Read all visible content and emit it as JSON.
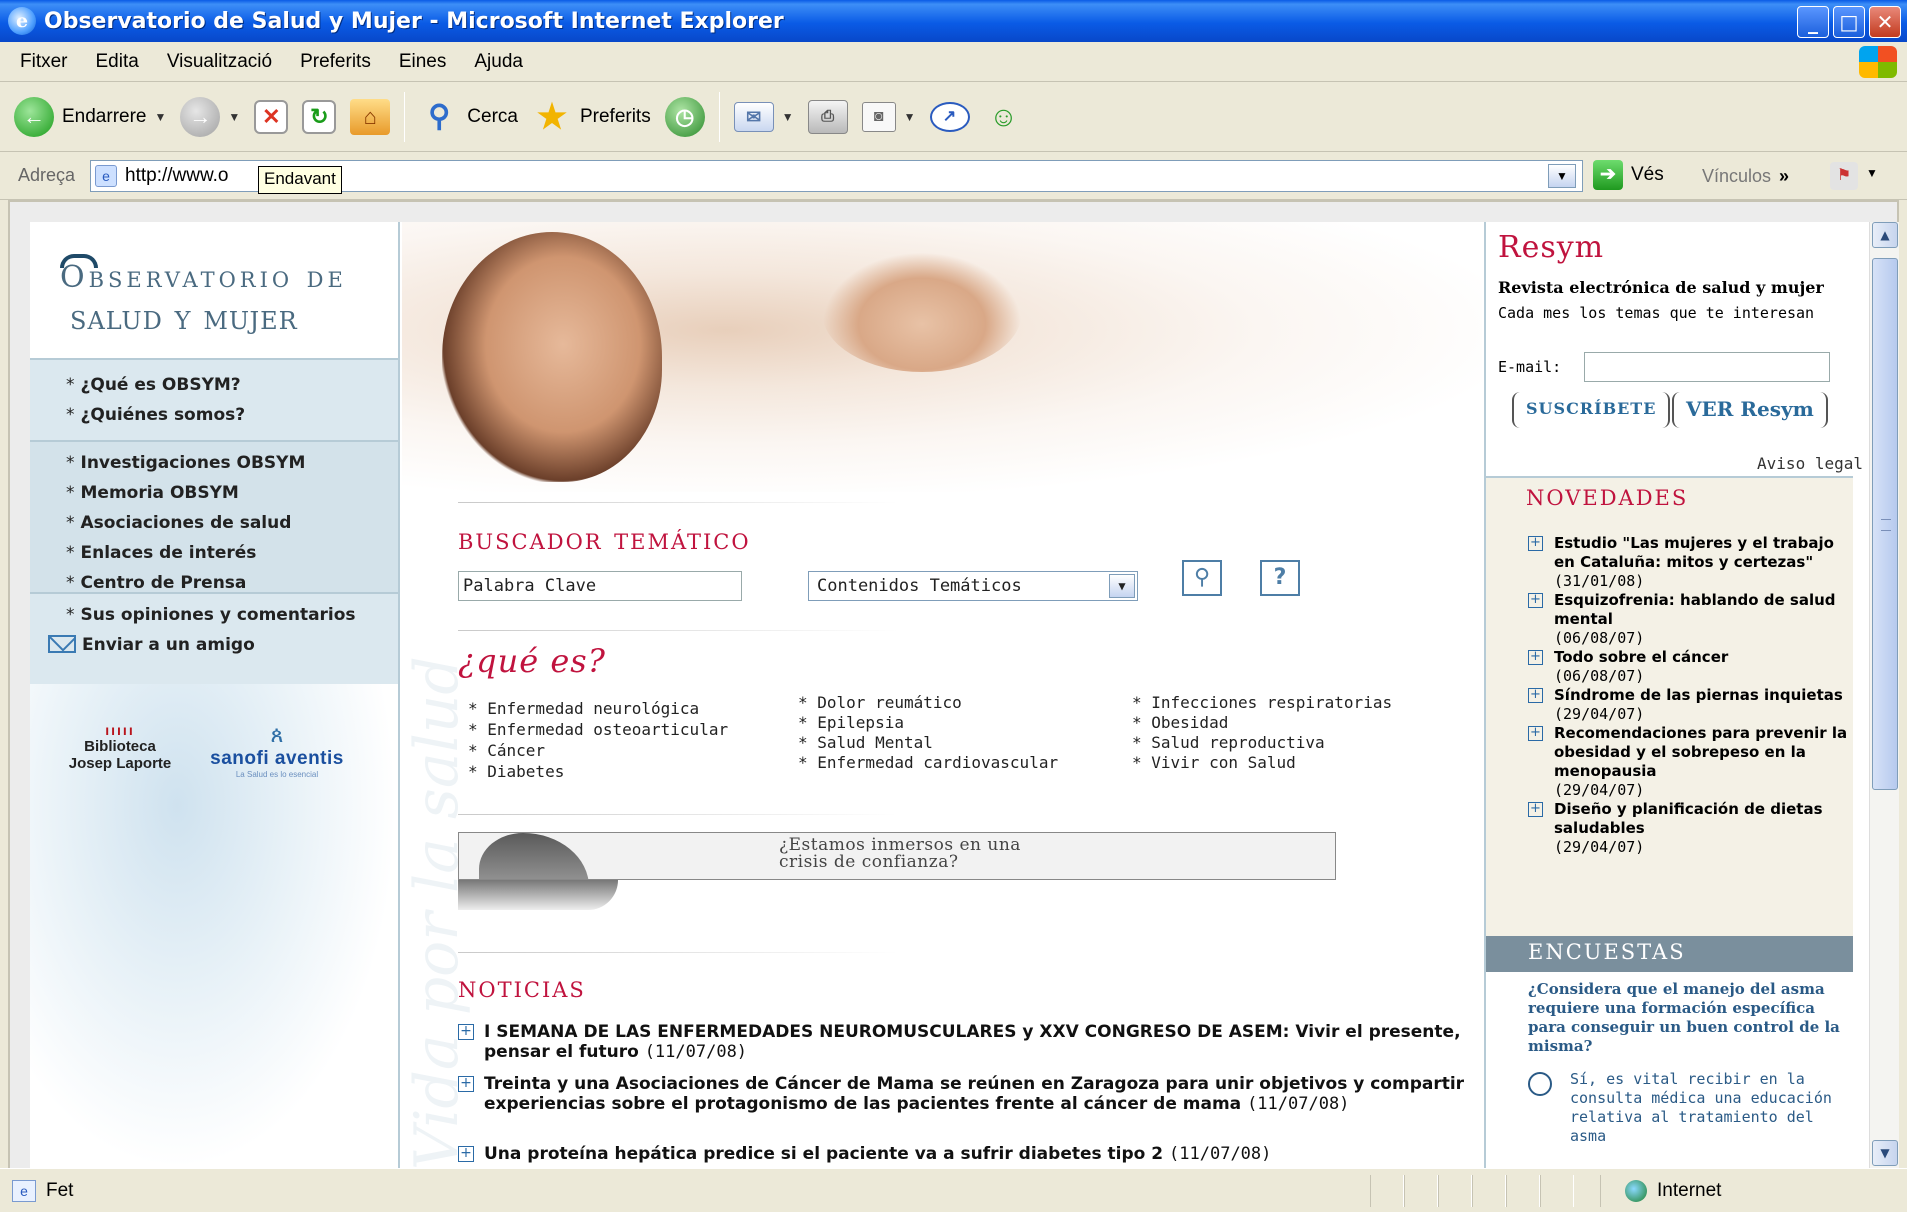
{
  "window": {
    "title": "Observatorio de Salud y Mujer - Microsoft Internet Explorer",
    "buttons": {
      "minimize": "_",
      "maximize": "□",
      "close": "✕"
    }
  },
  "menu": [
    "Fitxer",
    "Edita",
    "Visualització",
    "Preferits",
    "Eines",
    "Ajuda"
  ],
  "toolbar": {
    "back": "Endarrere",
    "search": "Cerca",
    "favorites": "Preferits"
  },
  "address": {
    "label": "Adreça",
    "url": "http://www.o",
    "tooltip": "Endavant",
    "go": "Vés",
    "links": "Vínculos",
    "more": "»"
  },
  "site": {
    "logo_line1": "Observatorio de",
    "logo_line2": "salud y mujer",
    "nav_group1": [
      "¿Qué es OBSYM?",
      "¿Quiénes somos?"
    ],
    "nav_group2": [
      "Investigaciones OBSYM",
      "Memoria OBSYM",
      "Asociaciones de salud",
      "Enlaces de interés",
      "Centro de Prensa"
    ],
    "nav_opinions": "Sus opiniones y comentarios",
    "nav_send": "Enviar a un amigo",
    "sponsor1_marks": "ııııı",
    "sponsor1_name": "Biblioteca",
    "sponsor1_name2": "Josep Laporte",
    "sponsor2_name": "sanofi aventis",
    "sponsor2_tagline": "La Salud es lo esencial",
    "vertical_text": "Vida por la salud"
  },
  "search": {
    "title": "buscador temático",
    "keyword_value": "Palabra Clave",
    "select_value": "Contenidos Temáticos",
    "help_label": "?"
  },
  "quees": {
    "title": "¿qué es?",
    "col1": [
      "Enfermedad neurológica",
      "Enfermedad osteoarticular",
      "Cáncer",
      "Diabetes"
    ],
    "col2": [
      "Dolor reumático",
      "Epilepsia",
      "Salud Mental",
      "Enfermedad cardiovascular"
    ],
    "col3": [
      "Infecciones respiratorias",
      "Obesidad",
      "Salud reproductiva",
      "Vivir con Salud"
    ]
  },
  "banner": {
    "line1": "¿Estamos inmersos en una",
    "line2": "crisis de confianza?"
  },
  "noticias": {
    "title": "noticias",
    "items": [
      {
        "text": "I SEMANA DE LAS ENFERMEDADES NEUROMUSCULARES y XXV CONGRESO DE ASEM: Vivir el presente, pensar el futuro",
        "date": "(11/07/08)"
      },
      {
        "text": "Treinta y una Asociaciones de Cáncer de Mama se reúnen en Zaragoza para unir objetivos y compartir experiencias sobre el protagonismo de las pacientes frente al cáncer de mama",
        "date": "(11/07/08)"
      },
      {
        "text": "Una proteína hepática predice si el paciente va a sufrir diabetes tipo 2",
        "date": "(11/07/08)"
      }
    ]
  },
  "resym": {
    "title": "Resym",
    "subtitle": "Revista electrónica de salud y mujer",
    "desc": "Cada mes los temas que te interesan",
    "email_label": "E-mail:",
    "email_value": "",
    "subscribe": "SUSCRÍBETE",
    "ver": "VER Resym",
    "aviso": "Aviso legal"
  },
  "novedades": {
    "title": "novedades",
    "items": [
      {
        "text": "Estudio \"Las mujeres y el trabajo en Cataluña: mitos y certezas\"",
        "date": "(31/01/08)"
      },
      {
        "text": "Esquizofrenia: hablando de salud mental",
        "date": "(06/08/07)"
      },
      {
        "text": "Todo sobre el cáncer",
        "date": "(06/08/07)"
      },
      {
        "text": "Síndrome de las piernas inquietas",
        "date": "(29/04/07)"
      },
      {
        "text": "Recomendaciones para prevenir la obesidad y el sobrepeso en la menopausia",
        "date": "(29/04/07)"
      },
      {
        "text": "Diseño y planificación de dietas saludables",
        "date": "(29/04/07)"
      }
    ]
  },
  "encuestas": {
    "title": "encuestas",
    "question": "¿Considera que el manejo del asma requiere una formación específica para conseguir un buen control de la misma?",
    "option1": "Sí, es vital recibir en la consulta médica una educación relativa al tratamiento del asma"
  },
  "status": {
    "text": "Fet",
    "zone": "Internet"
  }
}
